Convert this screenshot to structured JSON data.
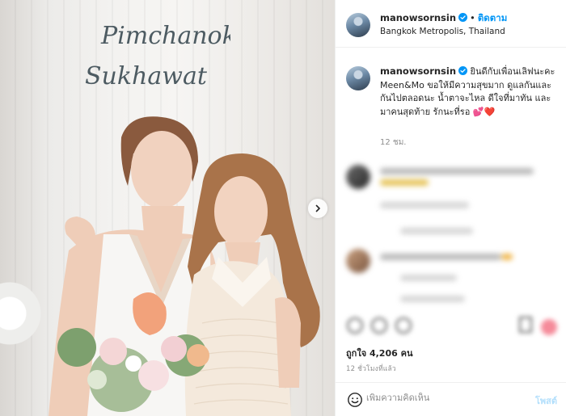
{
  "header": {
    "username": "manowsornsin",
    "separator": "•",
    "follow_label": "ติดตาม",
    "location": "Bangkok Metropolis, Thailand"
  },
  "photo": {
    "sign_line1": "Pimchanok",
    "sign_line2": "Sukhawat"
  },
  "caption": {
    "username": "manowsornsin",
    "text": "ยินดีกับเพื่อนเลิฟนะคะ Meen&Mo ขอให้มีความสุขมาก ดูแลกันและกันไปตลอดนะ น้ำตาจะไหล ดีใจที่มาทัน และมาคนสุดท้าย รักนะที่รอ 💕❤️",
    "time": "12 ชม."
  },
  "likes": "ถูกใจ 4,206 คน",
  "posted_ago": "12 ชั่วโมงที่แล้ว",
  "comment_box": {
    "placeholder": "เพิ่มความคิดเห็น",
    "post_label": "โพสต์"
  },
  "colors": {
    "accent": "#0095f6",
    "post_disabled": "#b2dffc",
    "muted": "#8e8e8e"
  }
}
